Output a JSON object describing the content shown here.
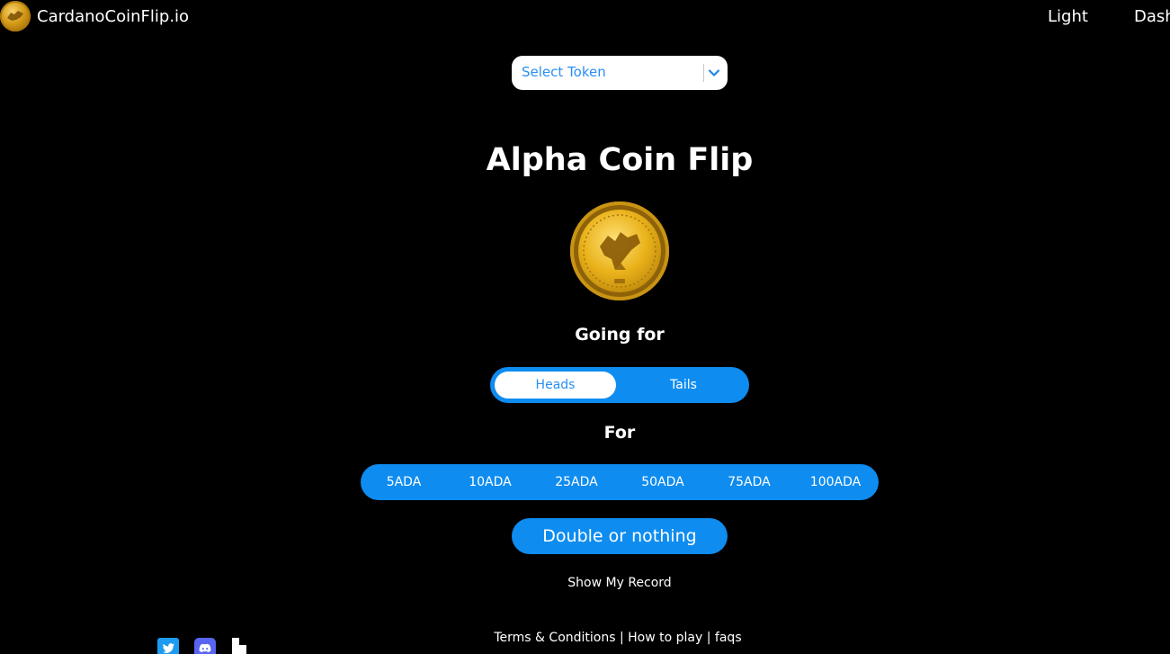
{
  "header": {
    "brand_name": "CardanoCoinFlip.io",
    "nav": [
      "Light",
      "Dash"
    ]
  },
  "token_select": {
    "placeholder": "Select Token",
    "icon": "chevron-down-icon"
  },
  "game": {
    "title": "Alpha Coin Flip",
    "going_for_label": "Going for",
    "sides": {
      "heads": "Heads",
      "tails": "Tails",
      "selected": "Heads"
    },
    "for_label": "For",
    "amounts": [
      "5ADA",
      "10ADA",
      "25ADA",
      "50ADA",
      "75ADA",
      "100ADA"
    ],
    "action_button": "Double or nothing",
    "show_record": "Show My Record"
  },
  "footer": {
    "terms": "Terms & Conditions",
    "sep1": " | ",
    "how_to_play": "How to play",
    "sep2": " | ",
    "faqs": "faqs",
    "socials": [
      "twitter-icon",
      "discord-icon",
      "medium-icon"
    ]
  },
  "colors": {
    "background": "#000000",
    "accent": "#0e8cf0",
    "text": "#ffffff"
  }
}
